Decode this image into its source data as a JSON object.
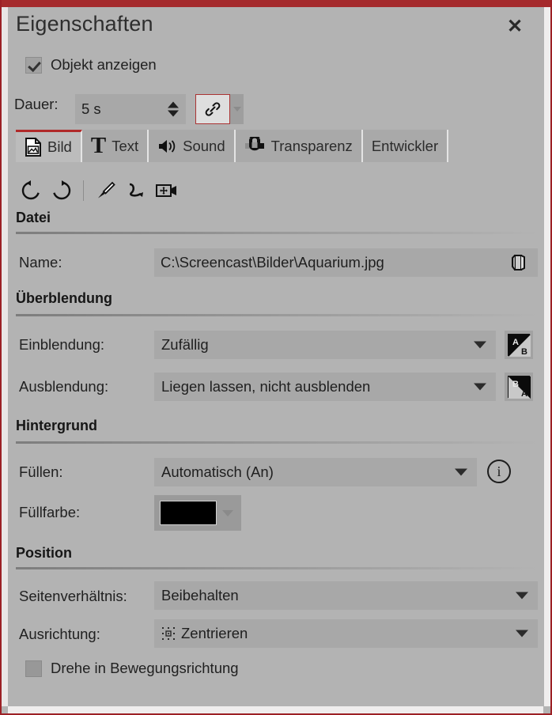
{
  "window": {
    "title": "Eigenschaften",
    "close_label": "✕",
    "accent_color": "#a52a2c",
    "background_color": "#b3b3b3"
  },
  "visibility": {
    "label": "Objekt anzeigen",
    "checked": true
  },
  "duration": {
    "label": "Dauer:",
    "value": "5 s",
    "link_icon": "link-chain-icon",
    "link_active": true
  },
  "tabs": [
    {
      "label": "Bild",
      "icon": "image-file-icon",
      "active": true
    },
    {
      "label": "Text",
      "icon": "text-t-icon",
      "active": false
    },
    {
      "label": "Sound",
      "icon": "speaker-icon",
      "active": false
    },
    {
      "label": "Transparenz",
      "icon": "magnet-icon",
      "active": false
    },
    {
      "label": "Entwickler",
      "icon": "",
      "active": false
    }
  ],
  "toolbar_icons": [
    {
      "name": "rotate-left-icon"
    },
    {
      "name": "rotate-right-icon"
    },
    {
      "name": "separator"
    },
    {
      "name": "brush-icon"
    },
    {
      "name": "curve-path-icon"
    },
    {
      "name": "camera-move-icon"
    }
  ],
  "sections": {
    "datei": {
      "title": "Datei",
      "name_label": "Name:",
      "name_value": "C:\\Screencast\\Bilder\\Aquarium.jpg",
      "browse_icon": "open-folder-icon"
    },
    "ueberblendung": {
      "title": "Überblendung",
      "fade_in_label": "Einblendung:",
      "fade_in_value": "Zufällig",
      "fade_in_button_icon": "transition-a-to-b-icon",
      "fade_in_button_top": "A",
      "fade_in_button_bottom": "B",
      "fade_out_label": "Ausblendung:",
      "fade_out_value": "Liegen lassen, nicht ausblenden",
      "fade_out_button_icon": "transition-b-to-a-icon",
      "fade_out_button_top": "B",
      "fade_out_button_bottom": "A"
    },
    "hintergrund": {
      "title": "Hintergrund",
      "fill_label": "Füllen:",
      "fill_value": "Automatisch (An)",
      "info_icon": "info-icon",
      "info_glyph": "i",
      "fill_color_label": "Füllfarbe:",
      "fill_color_value": "#000000"
    },
    "position": {
      "title": "Position",
      "aspect_label": "Seitenverhältnis:",
      "aspect_value": "Beibehalten",
      "align_label": "Ausrichtung:",
      "align_value": "Zentrieren",
      "align_icon": "center-align-grid-icon",
      "rotate_label": "Drehe in Bewegungsrichtung",
      "rotate_checked": false
    }
  }
}
